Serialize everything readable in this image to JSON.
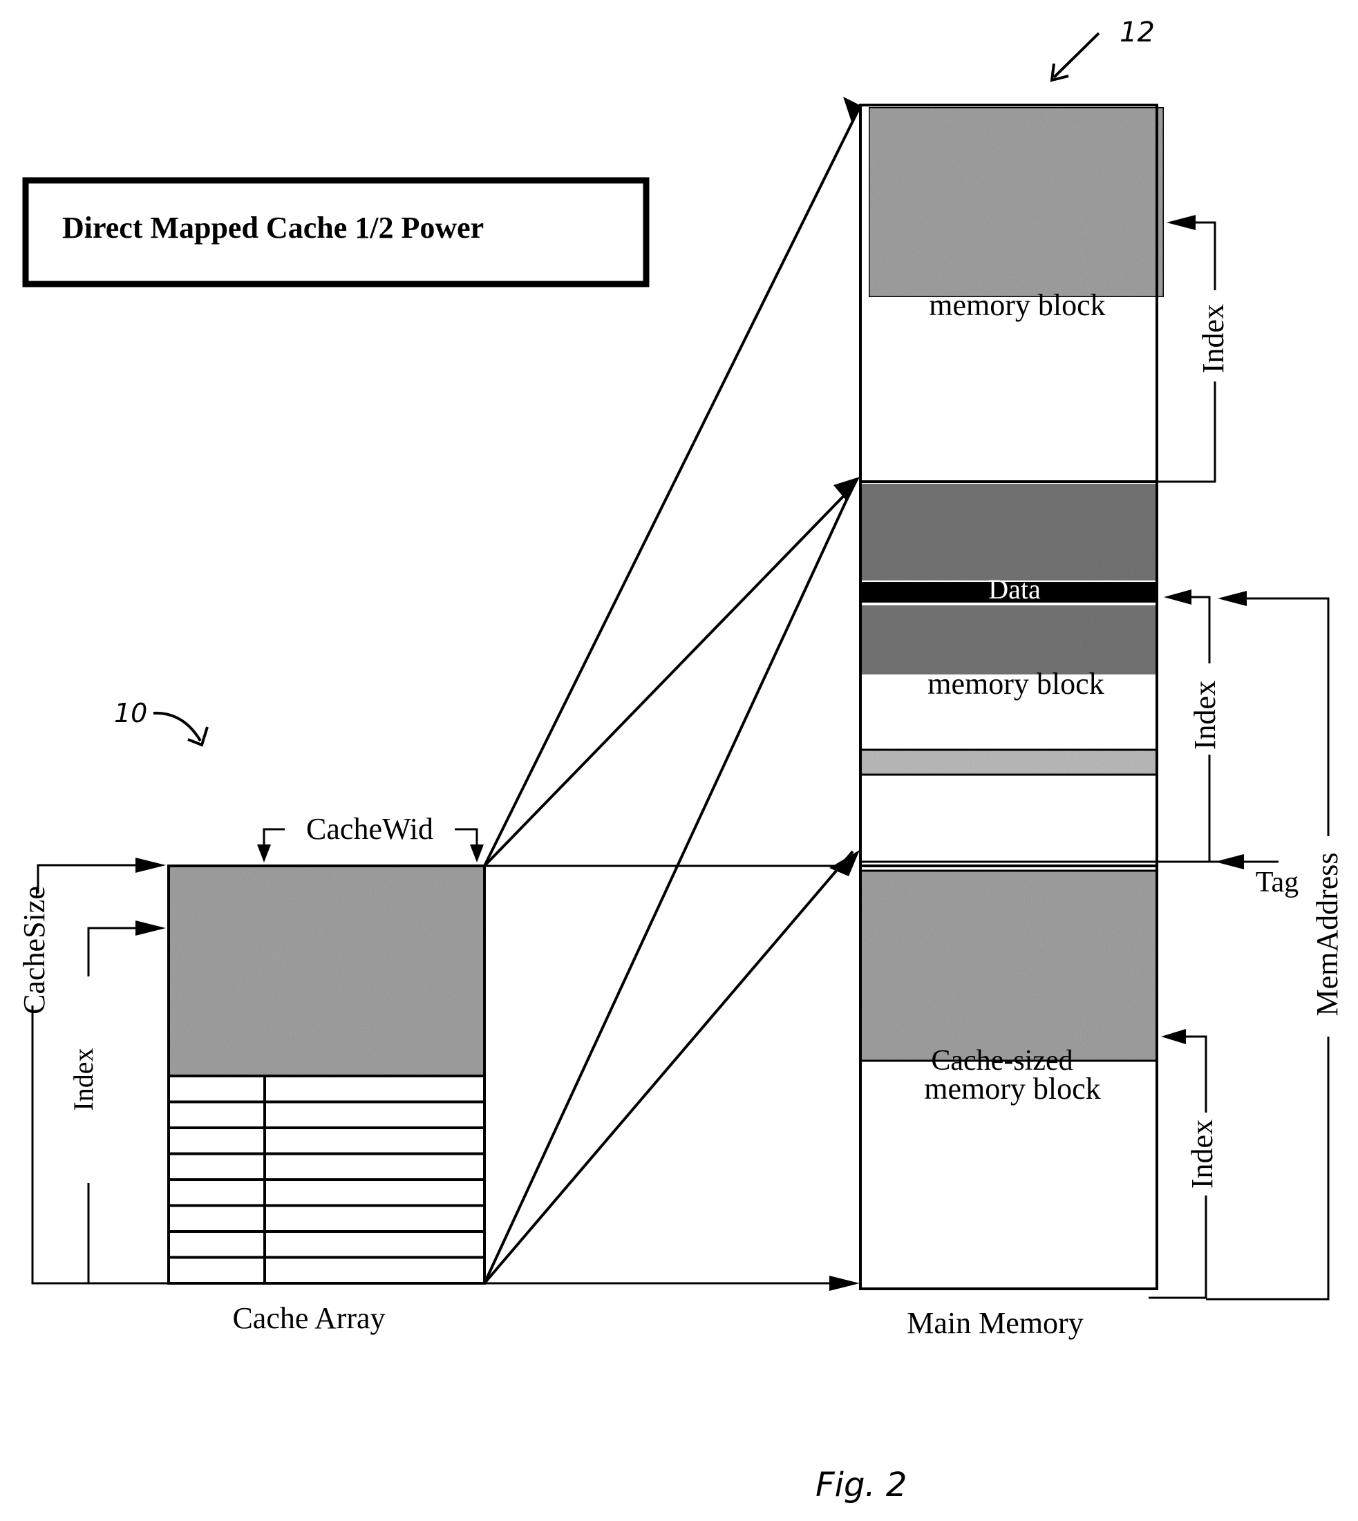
{
  "title": "Direct Mapped Cache 1/2 Power",
  "reference_numerals": {
    "cache": "10",
    "main_memory": "12"
  },
  "figure_label": "Fig. 2",
  "cache_array": {
    "label": "Cache Array",
    "width_label": "CacheWid",
    "size_label": "CacheSize",
    "index_label": "Index",
    "row_count": 8
  },
  "main_memory": {
    "label": "Main Memory",
    "blocks": [
      {
        "label": "memory block",
        "shade": "grey"
      },
      {
        "label": "memory block",
        "shade": "dark-grey",
        "highlight_label": "Data"
      },
      {
        "label_line1": "Cache-sized",
        "label_line2": "memory block",
        "shade": "grey"
      }
    ],
    "index_labels": [
      "Index",
      "Index",
      "Index"
    ],
    "tag_label": "Tag",
    "address_label": "MemAddress"
  },
  "colors": {
    "grey": "#a8a8a8",
    "dark_grey": "#7a7a7a",
    "light_grey": "#c4c4c4",
    "black": "#000000"
  }
}
